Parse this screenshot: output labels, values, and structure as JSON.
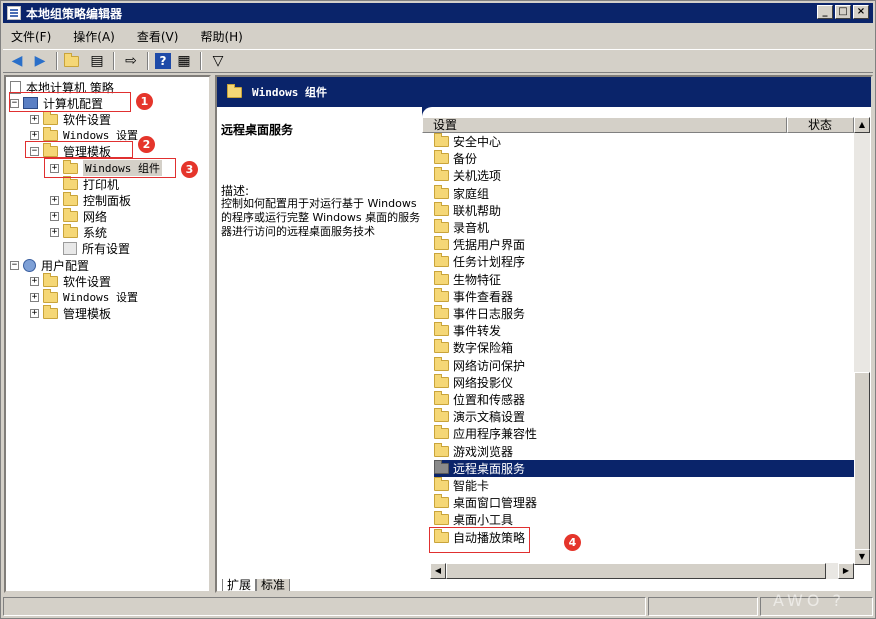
{
  "window": {
    "title": "本地组策略编辑器",
    "buttons": {
      "minimize": "_",
      "maximize": "□",
      "close": "×"
    }
  },
  "menu": [
    "文件(F)",
    "操作(A)",
    "查看(V)",
    "帮助(H)"
  ],
  "tree": {
    "root": "本地计算机 策略",
    "computer_config": "计算机配置",
    "software_settings": "软件设置",
    "windows_settings": "Windows 设置",
    "admin_templates": "管理模板",
    "windows_components": "Windows 组件",
    "printers": "打印机",
    "control_panel": "控制面板",
    "network": "网络",
    "system": "系统",
    "all_settings": "所有设置",
    "user_config": "用户配置",
    "user_software_settings": "软件设置",
    "user_windows_settings": "Windows 设置",
    "user_admin_templates": "管理模板"
  },
  "expanders": {
    "plus": "+",
    "minus": "−"
  },
  "badges": {
    "b1": "1",
    "b2": "2",
    "b3": "3",
    "b4": "4"
  },
  "right": {
    "header": "Windows 组件",
    "desc_title": "远程桌面服务",
    "desc_label": "描述:",
    "desc_text": "控制如何配置用于对运行基于 Windows 的程序或运行完整 Windows 桌面的服务器进行访问的远程桌面服务技术",
    "col_settings": "设置",
    "col_status": "状态",
    "items": [
      "安全中心",
      "备份",
      "关机选项",
      "家庭组",
      "联机帮助",
      "录音机",
      "凭据用户界面",
      "任务计划程序",
      "生物特征",
      "事件查看器",
      "事件日志服务",
      "事件转发",
      "数字保险箱",
      "网络访问保护",
      "网络投影仪",
      "位置和传感器",
      "演示文稿设置",
      "应用程序兼容性",
      "游戏浏览器",
      "远程桌面服务",
      "智能卡",
      "桌面窗口管理器",
      "桌面小工具",
      "自动播放策略"
    ],
    "selected_item": "远程桌面服务"
  },
  "tabs": [
    "扩展",
    "标准"
  ],
  "watermark": "AWO ?"
}
